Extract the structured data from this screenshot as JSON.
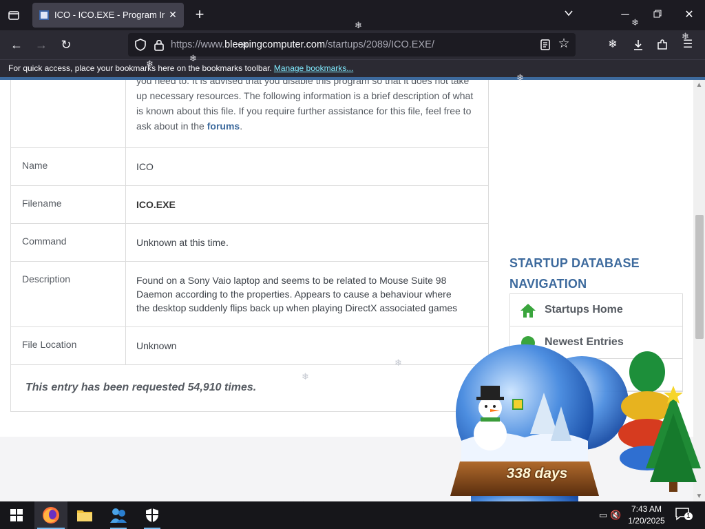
{
  "browser": {
    "tab": {
      "title": "ICO - ICO.EXE - Program Information"
    },
    "url": {
      "domain": "bleepingcomputer.com",
      "prefix": "https://www.",
      "path": "/startups/2089/ICO.EXE/"
    },
    "bookmarks_bar": {
      "message": "For quick access, place your bookmarks here on the bookmarks toolbar.",
      "link": "Manage bookmarks..."
    },
    "icons": [
      "tab-list-icon",
      "close-icon",
      "plus-icon",
      "chevron-down-icon",
      "minimize-icon",
      "restore-icon",
      "back-icon",
      "forward-icon",
      "reload-icon",
      "shield-icon",
      "lock-icon",
      "reader-mode-icon",
      "star-icon",
      "download-icon",
      "extensions-icon",
      "menu-icon"
    ]
  },
  "content": {
    "intro": {
      "line_partial": "you need to. It is advised that you disable this program so that it does not",
      "text": "take up necessary resources. The following information is a brief description of what is known about this file. If you require further assistance for this file, feel free to ask about in the",
      "link": "forums",
      "end": "."
    },
    "rows": [
      {
        "label": "Name",
        "value": "ICO"
      },
      {
        "label": "Filename",
        "value": "ICO.EXE"
      },
      {
        "label": "Command",
        "value": "Unknown at this time."
      },
      {
        "label": "Description",
        "value": "Found on a Sony Vaio laptop and seems to be related to Mouse Suite 98 Daemon according to the properties. Appears to cause a behaviour where the desktop suddenly flips back up when playing DirectX associated games"
      },
      {
        "label": "File Location",
        "value": "Unknown"
      }
    ],
    "requested": "This entry has been requested 54,910 times."
  },
  "sidebar": {
    "heading_line1": "STARTUP DATABASE",
    "heading_line2": "NAVIGATION",
    "items": [
      {
        "label": "Startups Home",
        "icon": "home-icon"
      },
      {
        "label": "Newest Entries",
        "icon": "new-icon"
      }
    ]
  },
  "widget": {
    "days": "338 days"
  },
  "taskbar": {
    "time": "7:43 AM",
    "date": "1/20/2025",
    "notification_count": "1",
    "apps": [
      "windows-start-icon",
      "firefox-icon",
      "file-explorer-icon",
      "people-app-icon",
      "security-shield-icon"
    ]
  },
  "colors": {
    "accent": "#3d6a9d",
    "chrome_dark": "#1c1b22",
    "chrome": "#2b2a33",
    "link_chrome": "#80ebff"
  }
}
